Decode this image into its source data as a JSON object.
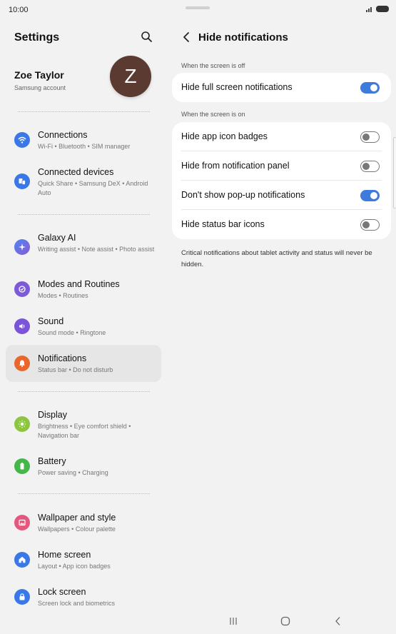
{
  "status": {
    "time": "10:00"
  },
  "left": {
    "title": "Settings",
    "profile": {
      "name": "Zoe Taylor",
      "subtitle": "Samsung account",
      "avatar_letter": "Z"
    },
    "items": [
      {
        "title": "Connections",
        "subtitle": "Wi-Fi  •  Bluetooth  •  SIM manager",
        "icon": "wifi-icon",
        "color": "#3b78e7"
      },
      {
        "title": "Connected devices",
        "subtitle": "Quick Share  •  Samsung DeX  •  Android Auto",
        "icon": "connected-devices-icon",
        "color": "#3b78e7"
      },
      {
        "title": "Galaxy AI",
        "subtitle": "Writing assist  •  Note assist  •  Photo assist",
        "icon": "galaxy-ai-icon",
        "color": "#6b5bd6"
      },
      {
        "title": "Modes and Routines",
        "subtitle": "Modes  •  Routines",
        "icon": "modes-icon",
        "color": "#7d5bd8"
      },
      {
        "title": "Sound",
        "subtitle": "Sound mode  •  Ringtone",
        "icon": "sound-icon",
        "color": "#7a55d9"
      },
      {
        "title": "Notifications",
        "subtitle": "Status bar  •  Do not disturb",
        "icon": "notifications-icon",
        "color": "#e9672d"
      },
      {
        "title": "Display",
        "subtitle": "Brightness  •  Eye comfort shield  •  Navigation bar",
        "icon": "display-icon",
        "color": "#8cc63f"
      },
      {
        "title": "Battery",
        "subtitle": "Power saving  •  Charging",
        "icon": "battery-icon",
        "color": "#45b649"
      },
      {
        "title": "Wallpaper and style",
        "subtitle": "Wallpapers  •  Colour palette",
        "icon": "wallpaper-icon",
        "color": "#e4587d"
      },
      {
        "title": "Home screen",
        "subtitle": "Layout  •  App icon badges",
        "icon": "home-icon",
        "color": "#3b78e7"
      },
      {
        "title": "Lock screen",
        "subtitle": "Screen lock and biometrics",
        "icon": "lock-icon",
        "color": "#3b78e7"
      }
    ]
  },
  "right": {
    "title": "Hide notifications",
    "section_off": "When the screen is off",
    "section_on": "When the screen is on",
    "toggles": [
      {
        "label": "Hide full screen notifications",
        "state": "on"
      },
      {
        "label": "Hide app icon badges",
        "state": "off"
      },
      {
        "label": "Hide from notification panel",
        "state": "off"
      },
      {
        "label": "Don't show pop-up notifications",
        "state": "on"
      },
      {
        "label": "Hide status bar icons",
        "state": "off"
      }
    ],
    "note": "Critical notifications about tablet activity and status will never be hidden."
  },
  "colors": {
    "accent": "#3f7bdc",
    "selected_bg": "#e6e6e6",
    "avatar": "#5a3a31"
  }
}
